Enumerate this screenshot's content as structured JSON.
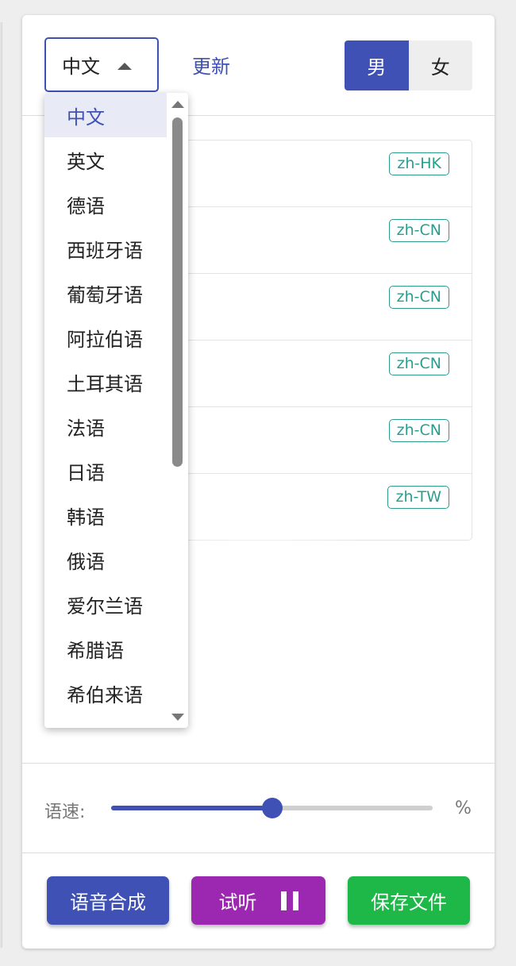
{
  "header": {
    "language_selected": "中文",
    "refresh_label": "更新",
    "gender_options": [
      "男",
      "女"
    ],
    "gender_active": "男"
  },
  "voices": [
    {
      "tag": "zh-HK"
    },
    {
      "tag": "zh-CN"
    },
    {
      "tag": "zh-CN"
    },
    {
      "tag": "zh-CN"
    },
    {
      "tag": "zh-CN"
    },
    {
      "tag": "zh-TW"
    }
  ],
  "dropdown": {
    "options": [
      "中文",
      "英文",
      "德语",
      "西班牙语",
      "葡萄牙语",
      "阿拉伯语",
      "土耳其语",
      "法语",
      "日语",
      "韩语",
      "俄语",
      "爱尔兰语",
      "希腊语",
      "希伯来语"
    ],
    "selected_index": 0
  },
  "speed": {
    "label": "语速:",
    "unit": "%",
    "level_fraction": 0.5
  },
  "buttons": {
    "synthesize": "语音合成",
    "listen": "试听",
    "save": "保存文件"
  },
  "colors": {
    "primary": "#3f51b5",
    "listen": "#9c27b0",
    "save": "#1db848",
    "tag": "#2a9d8f"
  }
}
